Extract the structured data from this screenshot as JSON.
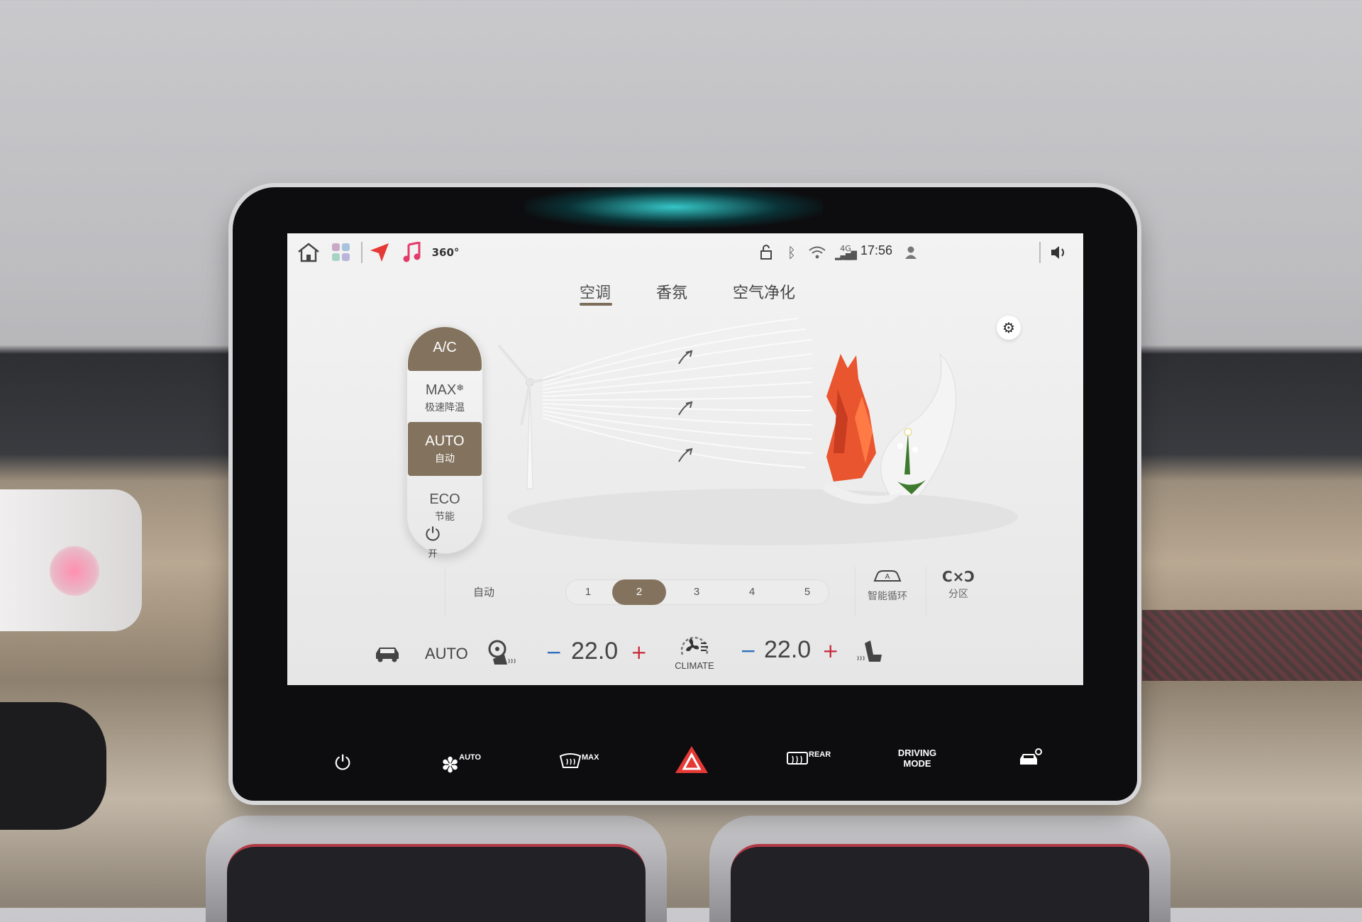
{
  "status_bar": {
    "time": "17:56",
    "network": "4G",
    "camera_label": "360°"
  },
  "tabs": [
    {
      "label": "空调",
      "active": true
    },
    {
      "label": "香氛",
      "active": false
    },
    {
      "label": "空气净化",
      "active": false
    }
  ],
  "modes": [
    {
      "label": "A/C",
      "sub": "",
      "active": true
    },
    {
      "label": "MAX",
      "sub": "极速降温",
      "active": false
    },
    {
      "label": "AUTO",
      "sub": "自动",
      "active": true
    },
    {
      "label": "ECO",
      "sub": "节能",
      "active": false
    }
  ],
  "fan": {
    "power_label": "开",
    "auto_label": "自动",
    "speeds": [
      "1",
      "2",
      "3",
      "4",
      "5"
    ],
    "selected_speed": "2",
    "recirc_label": "智能循环",
    "zone_label": "分区"
  },
  "bottom_bar": {
    "mode": "AUTO",
    "left_temp": "22.0",
    "right_temp": "22.0",
    "minus": "−",
    "plus": "+",
    "climate_label": "CLIMATE"
  },
  "hard_keys": {
    "fan_auto": "AUTO",
    "defrost_max": "MAX",
    "rear": "REAR",
    "driving_mode_1": "DRIVING",
    "driving_mode_2": "MODE"
  },
  "colors": {
    "accent": "#83735e",
    "minus": "#2f6fb8",
    "plus": "#c7283a",
    "glow": "#3ce6e6"
  }
}
